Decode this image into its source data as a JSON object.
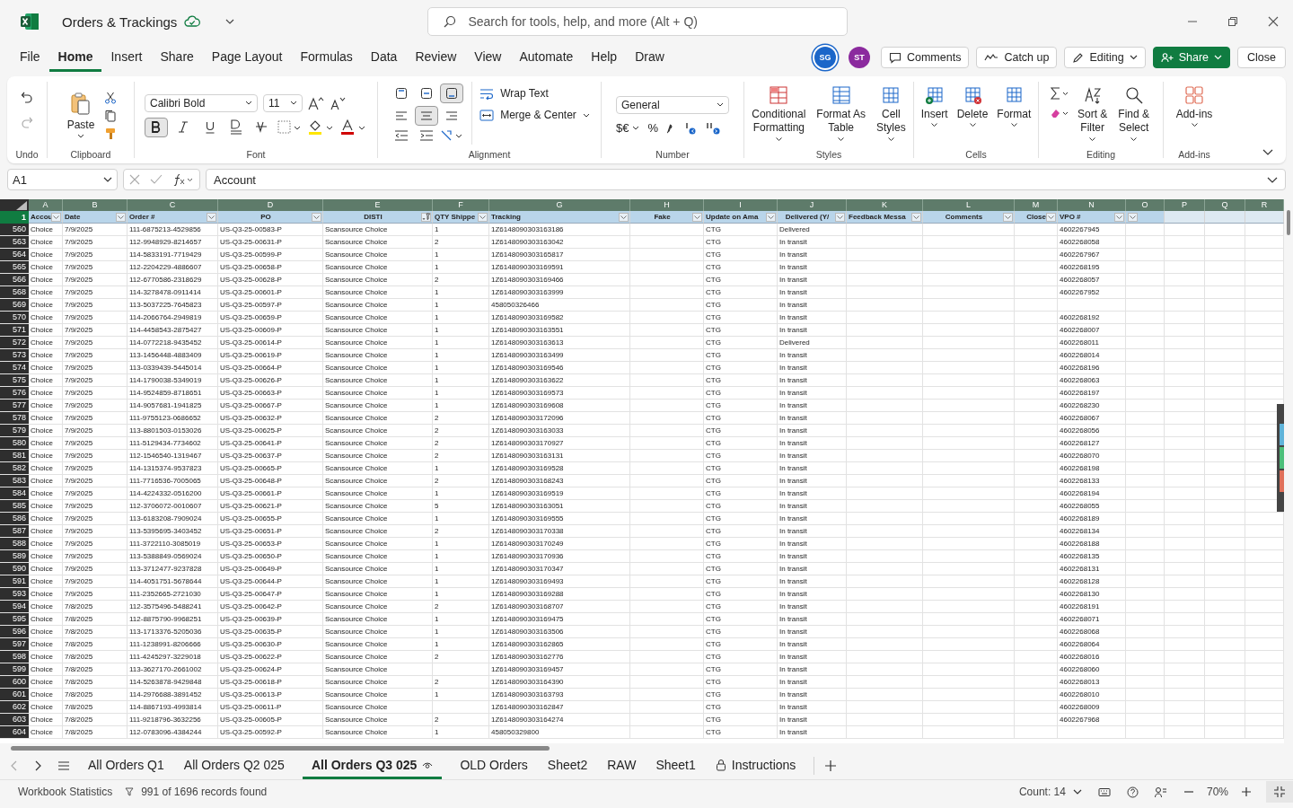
{
  "window": {
    "file_name": "Orders & Trackings"
  },
  "search": {
    "placeholder": "Search for tools, help, and more (Alt + Q)"
  },
  "menu": [
    {
      "label": "File",
      "selected": false
    },
    {
      "label": "Home",
      "selected": true
    },
    {
      "label": "Insert",
      "selected": false
    },
    {
      "label": "Share",
      "selected": false
    },
    {
      "label": "Page Layout",
      "selected": false
    },
    {
      "label": "Formulas",
      "selected": false
    },
    {
      "label": "Data",
      "selected": false
    },
    {
      "label": "Review",
      "selected": false
    },
    {
      "label": "View",
      "selected": false
    },
    {
      "label": "Automate",
      "selected": false
    },
    {
      "label": "Help",
      "selected": false
    },
    {
      "label": "Draw",
      "selected": false
    }
  ],
  "collaborators": [
    {
      "initials": "SG",
      "color": "#1b66c9"
    },
    {
      "initials": "ST",
      "color": "#8b2a9e"
    }
  ],
  "top_buttons": [
    {
      "label": "Comments",
      "kind": "comments"
    },
    {
      "label": "Catch up",
      "kind": "catchup"
    },
    {
      "label": "Editing",
      "kind": "editing"
    },
    {
      "label": "Share",
      "kind": "share"
    },
    {
      "label": "Close",
      "kind": "close"
    }
  ],
  "ribbon": {
    "undo_group": "Undo",
    "clipboard": {
      "group": "Clipboard",
      "paste": "Paste"
    },
    "font": {
      "group": "Font",
      "family": "Calibri Bold",
      "size": "11",
      "bold": true,
      "italic": false,
      "underline": false
    },
    "alignment": {
      "group": "Alignment",
      "vertical_buttons": [
        {
          "selected": false
        },
        {
          "selected": false
        },
        {
          "selected": true
        }
      ],
      "horizontal_buttons": [
        {
          "selected": false
        },
        {
          "selected": true
        },
        {
          "selected": false
        }
      ],
      "wrap_text": "Wrap Text",
      "merge": "Merge & Center"
    },
    "number": {
      "group": "Number",
      "format": "General",
      "currency": "$€",
      "percent": "%"
    },
    "styles": {
      "group": "Styles",
      "buttons": [
        {
          "lines": [
            "Conditional",
            "Formatting"
          ]
        },
        {
          "lines": [
            "Format As",
            "Table"
          ]
        },
        {
          "lines": [
            "Cell",
            "Styles"
          ]
        }
      ]
    },
    "cells": {
      "group": "Cells",
      "buttons": [
        "Insert",
        "Delete",
        "Format"
      ]
    },
    "editing": {
      "group": "Editing",
      "buttons": [
        {
          "lines": [
            "Sort &",
            "Filter"
          ]
        },
        {
          "lines": [
            "Find &",
            "Select"
          ]
        }
      ]
    },
    "addins": {
      "group": "Add-ins",
      "button": "Add-ins"
    }
  },
  "formula_bar": {
    "name_box": "A1",
    "formula": "Account"
  },
  "sheet": {
    "columns": [
      "A",
      "B",
      "C",
      "D",
      "E",
      "F",
      "G",
      "H",
      "I",
      "J",
      "K",
      "L",
      "M",
      "N",
      "O",
      "P",
      "Q",
      "R"
    ],
    "header_row": "1",
    "headers": [
      {
        "label": "Accou",
        "filtered": false
      },
      {
        "label": "Date",
        "filtered": false
      },
      {
        "label": "Order #",
        "filtered": false
      },
      {
        "label": "PO",
        "filtered": false
      },
      {
        "label": "DISTI",
        "filtered": true
      },
      {
        "label": "QTY Shippe",
        "filtered": false
      },
      {
        "label": "Tracking",
        "filtered": false
      },
      {
        "label": "Fake",
        "filtered": false
      },
      {
        "label": "Update on Ama",
        "filtered": false
      },
      {
        "label": "Delivered (Y/",
        "filtered": false
      },
      {
        "label": "Feedback Messa",
        "filtered": false
      },
      {
        "label": "Comments",
        "filtered": false
      },
      {
        "label": "Close",
        "filtered": false
      },
      {
        "label": "VPO #",
        "filtered": false
      },
      {
        "filtered": false
      }
    ],
    "rows": [
      {
        "n": "560",
        "account": "Choice",
        "date": "7/9/2025",
        "order": "111-6875213-4529856",
        "po": "US-Q3-25-00583-P",
        "disti": "Scansource Choice",
        "qty": "1",
        "tracking": "1Z6148090303163186",
        "update": "CTG",
        "delivered": "Delivered",
        "vpo": "4602267945"
      },
      {
        "n": "563",
        "account": "Choice",
        "date": "7/9/2025",
        "order": "112-9948929-8214657",
        "po": "US-Q3-25-00631-P",
        "disti": "Scansource Choice",
        "qty": "2",
        "tracking": "1Z6148090303163042",
        "update": "CTG",
        "delivered": "In transit",
        "vpo": "4602268058"
      },
      {
        "n": "564",
        "account": "Choice",
        "date": "7/9/2025",
        "order": "114-5833191-7719429",
        "po": "US-Q3-25-00599-P",
        "disti": "Scansource Choice",
        "qty": "1",
        "tracking": "1Z6148090303165817",
        "update": "CTG",
        "delivered": "In transit",
        "vpo": "4602267967"
      },
      {
        "n": "565",
        "account": "Choice",
        "date": "7/9/2025",
        "order": "112-2204229-4886607",
        "po": "US-Q3-25-00658-P",
        "disti": "Scansource Choice",
        "qty": "1",
        "tracking": "1Z6148090303169591",
        "update": "CTG",
        "delivered": "In transit",
        "vpo": "4602268195"
      },
      {
        "n": "566",
        "account": "Choice",
        "date": "7/9/2025",
        "order": "112-6770586-2318629",
        "po": "US-Q3-25-00628-P",
        "disti": "Scansource Choice",
        "qty": "2",
        "tracking": "1Z6148090303169466",
        "update": "CTG",
        "delivered": "In transit",
        "vpo": "4602268057"
      },
      {
        "n": "568",
        "account": "Choice",
        "date": "7/9/2025",
        "order": "114-3278478-0911414",
        "po": "US-Q3-25-00601-P",
        "disti": "Scansource Choice",
        "qty": "1",
        "tracking": "1Z6148090303163999",
        "update": "CTG",
        "delivered": "In transit",
        "vpo": "4602267952"
      },
      {
        "n": "569",
        "account": "Choice",
        "date": "7/9/2025",
        "order": "113-5037225-7645823",
        "po": "US-Q3-25-00597-P",
        "disti": "Scansource Choice",
        "qty": "1",
        "tracking": "458050326466",
        "update": "CTG",
        "delivered": "In transit"
      },
      {
        "n": "570",
        "account": "Choice",
        "date": "7/9/2025",
        "order": "114-2066764-2949819",
        "po": "US-Q3-25-00659-P",
        "disti": "Scansource Choice",
        "qty": "1",
        "tracking": "1Z6148090303169582",
        "update": "CTG",
        "delivered": "In transit",
        "vpo": "4602268192"
      },
      {
        "n": "571",
        "account": "Choice",
        "date": "7/9/2025",
        "order": "114-4458543-2875427",
        "po": "US-Q3-25-00609-P",
        "disti": "Scansource Choice",
        "qty": "1",
        "tracking": "1Z6148090303163551",
        "update": "CTG",
        "delivered": "In transit",
        "vpo": "4602268007"
      },
      {
        "n": "572",
        "account": "Choice",
        "date": "7/9/2025",
        "order": "114-0772218-9435452",
        "po": "US-Q3-25-00614-P",
        "disti": "Scansource Choice",
        "qty": "1",
        "tracking": "1Z6148090303163613",
        "update": "CTG",
        "delivered": "Delivered",
        "vpo": "4602268011"
      },
      {
        "n": "573",
        "account": "Choice",
        "date": "7/9/2025",
        "order": "113-1456448-4883409",
        "po": "US-Q3-25-00619-P",
        "disti": "Scansource Choice",
        "qty": "1",
        "tracking": "1Z6148090303163499",
        "update": "CTG",
        "delivered": "In transit",
        "vpo": "4602268014"
      },
      {
        "n": "574",
        "account": "Choice",
        "date": "7/9/2025",
        "order": "113-0339439-5445014",
        "po": "US-Q3-25-00664-P",
        "disti": "Scansource Choice",
        "qty": "1",
        "tracking": "1Z6148090303169546",
        "update": "CTG",
        "delivered": "In transit",
        "vpo": "4602268196"
      },
      {
        "n": "575",
        "account": "Choice",
        "date": "7/9/2025",
        "order": "114-1790038-5349019",
        "po": "US-Q3-25-00626-P",
        "disti": "Scansource Choice",
        "qty": "1",
        "tracking": "1Z6148090303163622",
        "update": "CTG",
        "delivered": "In transit",
        "vpo": "4602268063"
      },
      {
        "n": "576",
        "account": "Choice",
        "date": "7/9/2025",
        "order": "114-9524859-8718651",
        "po": "US-Q3-25-00663-P",
        "disti": "Scansource Choice",
        "qty": "1",
        "tracking": "1Z6148090303169573",
        "update": "CTG",
        "delivered": "In transit",
        "vpo": "4602268197"
      },
      {
        "n": "577",
        "account": "Choice",
        "date": "7/9/2025",
        "order": "114-9057681-1941825",
        "po": "US-Q3-25-00667-P",
        "disti": "Scansource Choice",
        "qty": "1",
        "tracking": "1Z6148090303169608",
        "update": "CTG",
        "delivered": "In transit",
        "vpo": "4602268230"
      },
      {
        "n": "578",
        "account": "Choice",
        "date": "7/9/2025",
        "order": "111-9755123-0686652",
        "po": "US-Q3-25-00632-P",
        "disti": "Scansource Choice",
        "qty": "2",
        "tracking": "1Z6148090303172096",
        "update": "CTG",
        "delivered": "In transit",
        "vpo": "4602268067"
      },
      {
        "n": "579",
        "account": "Choice",
        "date": "7/9/2025",
        "order": "113-8801503-0153026",
        "po": "US-Q3-25-00625-P",
        "disti": "Scansource Choice",
        "qty": "2",
        "tracking": "1Z6148090303163033",
        "update": "CTG",
        "delivered": "In transit",
        "vpo": "4602268056"
      },
      {
        "n": "580",
        "account": "Choice",
        "date": "7/9/2025",
        "order": "111-5129434-7734602",
        "po": "US-Q3-25-00641-P",
        "disti": "Scansource Choice",
        "qty": "2",
        "tracking": "1Z6148090303170927",
        "update": "CTG",
        "delivered": "In transit",
        "vpo": "4602268127"
      },
      {
        "n": "581",
        "account": "Choice",
        "date": "7/9/2025",
        "order": "112-1546540-1319467",
        "po": "US-Q3-25-00637-P",
        "disti": "Scansource Choice",
        "qty": "2",
        "tracking": "1Z6148090303163131",
        "update": "CTG",
        "delivered": "In transit",
        "vpo": "4602268070"
      },
      {
        "n": "582",
        "account": "Choice",
        "date": "7/9/2025",
        "order": "114-1315374-9537823",
        "po": "US-Q3-25-00665-P",
        "disti": "Scansource Choice",
        "qty": "1",
        "tracking": "1Z6148090303169528",
        "update": "CTG",
        "delivered": "In transit",
        "vpo": "4602268198"
      },
      {
        "n": "583",
        "account": "Choice",
        "date": "7/9/2025",
        "order": "111-7716536-7005065",
        "po": "US-Q3-25-00648-P",
        "disti": "Scansource Choice",
        "qty": "2",
        "tracking": "1Z6148090303168243",
        "update": "CTG",
        "delivered": "In transit",
        "vpo": "4602268133"
      },
      {
        "n": "584",
        "account": "Choice",
        "date": "7/9/2025",
        "order": "114-4224332-0516200",
        "po": "US-Q3-25-00661-P",
        "disti": "Scansource Choice",
        "qty": "1",
        "tracking": "1Z6148090303169519",
        "update": "CTG",
        "delivered": "In transit",
        "vpo": "4602268194"
      },
      {
        "n": "585",
        "account": "Choice",
        "date": "7/9/2025",
        "order": "112-3706072-0010607",
        "po": "US-Q3-25-00621-P",
        "disti": "Scansource Choice",
        "qty": "5",
        "tracking": "1Z6148090303163051",
        "update": "CTG",
        "delivered": "In transit",
        "vpo": "4602268055"
      },
      {
        "n": "586",
        "account": "Choice",
        "date": "7/9/2025",
        "order": "113-6183208-7909024",
        "po": "US-Q3-25-00655-P",
        "disti": "Scansource Choice",
        "qty": "1",
        "tracking": "1Z6148090303169555",
        "update": "CTG",
        "delivered": "In transit",
        "vpo": "4602268189"
      },
      {
        "n": "587",
        "account": "Choice",
        "date": "7/9/2025",
        "order": "113-5395695-3403452",
        "po": "US-Q3-25-00651-P",
        "disti": "Scansource Choice",
        "qty": "2",
        "tracking": "1Z6148090303170338",
        "update": "CTG",
        "delivered": "In transit",
        "vpo": "4602268134"
      },
      {
        "n": "588",
        "account": "Choice",
        "date": "7/9/2025",
        "order": "111-3722110-3085019",
        "po": "US-Q3-25-00653-P",
        "disti": "Scansource Choice",
        "qty": "1",
        "tracking": "1Z6148090303170249",
        "update": "CTG",
        "delivered": "In transit",
        "vpo": "4602268188"
      },
      {
        "n": "589",
        "account": "Choice",
        "date": "7/9/2025",
        "order": "113-5388849-0569024",
        "po": "US-Q3-25-00650-P",
        "disti": "Scansource Choice",
        "qty": "1",
        "tracking": "1Z6148090303170936",
        "update": "CTG",
        "delivered": "In transit",
        "vpo": "4602268135"
      },
      {
        "n": "590",
        "account": "Choice",
        "date": "7/9/2025",
        "order": "113-3712477-9237828",
        "po": "US-Q3-25-00649-P",
        "disti": "Scansource Choice",
        "qty": "1",
        "tracking": "1Z6148090303170347",
        "update": "CTG",
        "delivered": "In transit",
        "vpo": "4602268131"
      },
      {
        "n": "591",
        "account": "Choice",
        "date": "7/9/2025",
        "order": "114-4051751-5678644",
        "po": "US-Q3-25-00644-P",
        "disti": "Scansource Choice",
        "qty": "1",
        "tracking": "1Z6148090303169493",
        "update": "CTG",
        "delivered": "In transit",
        "vpo": "4602268128"
      },
      {
        "n": "593",
        "account": "Choice",
        "date": "7/9/2025",
        "order": "111-2352665-2721030",
        "po": "US-Q3-25-00647-P",
        "disti": "Scansource Choice",
        "qty": "1",
        "tracking": "1Z6148090303169288",
        "update": "CTG",
        "delivered": "In transit",
        "vpo": "4602268130"
      },
      {
        "n": "594",
        "account": "Choice",
        "date": "7/8/2025",
        "order": "112-3575496-5488241",
        "po": "US-Q3-25-00642-P",
        "disti": "Scansource Choice",
        "qty": "2",
        "tracking": "1Z6148090303168707",
        "update": "CTG",
        "delivered": "In transit",
        "vpo": "4602268191"
      },
      {
        "n": "595",
        "account": "Choice",
        "date": "7/8/2025",
        "order": "112-8875790-9968251",
        "po": "US-Q3-25-00639-P",
        "disti": "Scansource Choice",
        "qty": "1",
        "tracking": "1Z6148090303169475",
        "update": "CTG",
        "delivered": "In transit",
        "vpo": "4602268071"
      },
      {
        "n": "596",
        "account": "Choice",
        "date": "7/8/2025",
        "order": "113-1713376-5205036",
        "po": "US-Q3-25-00635-P",
        "disti": "Scansource Choice",
        "qty": "1",
        "tracking": "1Z6148090303163506",
        "update": "CTG",
        "delivered": "In transit",
        "vpo": "4602268068"
      },
      {
        "n": "597",
        "account": "Choice",
        "date": "7/8/2025",
        "order": "111-1238991-8206666",
        "po": "US-Q3-25-00630-P",
        "disti": "Scansource Choice",
        "qty": "1",
        "tracking": "1Z6148090303162865",
        "update": "CTG",
        "delivered": "In transit",
        "vpo": "4602268064"
      },
      {
        "n": "598",
        "account": "Choice",
        "date": "7/8/2025",
        "order": "111-4245297-3229018",
        "po": "US-Q3-25-00622-P",
        "disti": "Scansource Choice",
        "qty": "2",
        "tracking": "1Z6148090303162776",
        "update": "CTG",
        "delivered": "In transit",
        "vpo": "4602268016"
      },
      {
        "n": "599",
        "account": "Choice",
        "date": "7/8/2025",
        "order": "113-3627170-2661002",
        "po": "US-Q3-25-00624-P",
        "disti": "Scansource Choice",
        "tracking": "1Z6148090303169457",
        "update": "CTG",
        "delivered": "In transit",
        "vpo": "4602268060"
      },
      {
        "n": "600",
        "account": "Choice",
        "date": "7/8/2025",
        "order": "114-5263878-9429848",
        "po": "US-Q3-25-00618-P",
        "disti": "Scansource Choice",
        "qty": "2",
        "tracking": "1Z6148090303164390",
        "update": "CTG",
        "delivered": "In transit",
        "vpo": "4602268013"
      },
      {
        "n": "601",
        "account": "Choice",
        "date": "7/8/2025",
        "order": "114-2976688-3891452",
        "po": "US-Q3-25-00613-P",
        "disti": "Scansource Choice",
        "qty": "1",
        "tracking": "1Z6148090303163793",
        "update": "CTG",
        "delivered": "In transit",
        "vpo": "4602268010"
      },
      {
        "n": "602",
        "account": "Choice",
        "date": "7/8/2025",
        "order": "114-8867193-4993814",
        "po": "US-Q3-25-00611-P",
        "disti": "Scansource Choice",
        "tracking": "1Z6148090303162847",
        "update": "CTG",
        "delivered": "In transit",
        "vpo": "4602268009"
      },
      {
        "n": "603",
        "account": "Choice",
        "date": "7/8/2025",
        "order": "111-9218796-3632256",
        "po": "US-Q3-25-00605-P",
        "disti": "Scansource Choice",
        "qty": "2",
        "tracking": "1Z6148090303164274",
        "update": "CTG",
        "delivered": "In transit",
        "vpo": "4602267968"
      },
      {
        "n": "604",
        "account": "Choice",
        "date": "7/8/2025",
        "order": "112-0783096-4384244",
        "po": "US-Q3-25-00592-P",
        "disti": "Scansource Choice",
        "qty": "1",
        "tracking": "458050329800",
        "update": "CTG",
        "delivered": "In transit"
      }
    ]
  },
  "sheet_tabs": [
    {
      "label": "All Orders Q1",
      "selected": false,
      "kind": "plain"
    },
    {
      "label": "All Orders Q2 025",
      "selected": false,
      "kind": "plain"
    },
    {
      "label": "All Orders Q3 025",
      "selected": true,
      "kind": "watched"
    },
    {
      "label": "OLD Orders",
      "selected": false,
      "kind": "plain"
    },
    {
      "label": "Sheet2",
      "selected": false,
      "kind": "plain"
    },
    {
      "label": "RAW",
      "selected": false,
      "kind": "plain"
    },
    {
      "label": "Sheet1",
      "selected": false,
      "kind": "plain"
    },
    {
      "label": "Instructions",
      "selected": false,
      "kind": "locked"
    }
  ],
  "status_bar": {
    "statistics": "Workbook Statistics",
    "filter_result": "991 of 1696 records found",
    "count": "Count: 14",
    "zoom": "70%"
  }
}
